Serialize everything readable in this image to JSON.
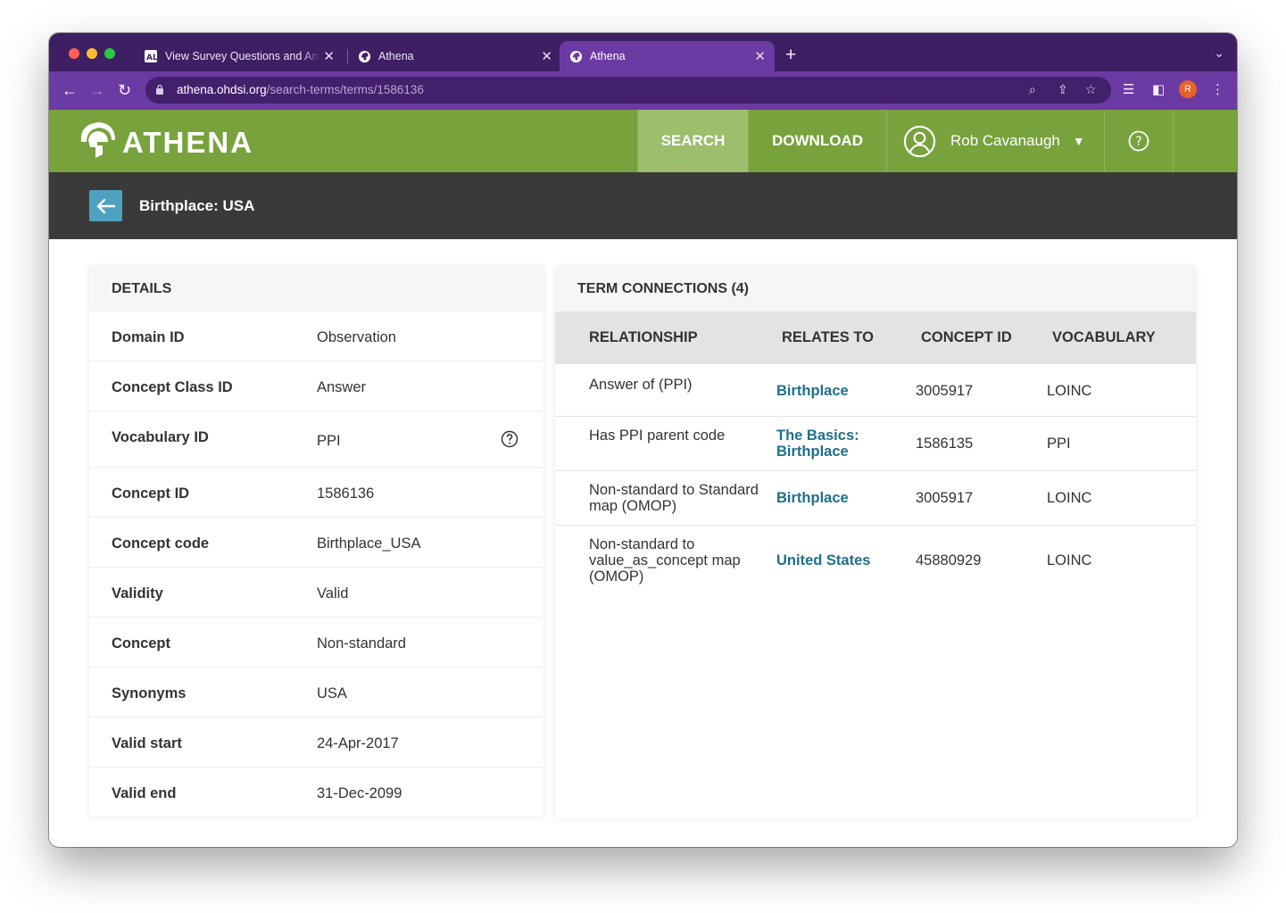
{
  "browser": {
    "tabs": [
      {
        "title": "View Survey Questions and Answers",
        "favicon": "survey-logo-icon"
      },
      {
        "title": "Athena",
        "favicon": "athena-helmet-icon"
      },
      {
        "title": "Athena",
        "favicon": "athena-helmet-icon",
        "active": true
      }
    ],
    "url_host": "athena.ohdsi.org",
    "url_path": "/search-terms/terms/1586136",
    "profile_initial": "R"
  },
  "app": {
    "logo_text": "ATHENA",
    "nav": {
      "search": "SEARCH",
      "download": "DOWNLOAD",
      "user": "Rob Cavanaugh",
      "help": "?"
    },
    "colors": {
      "header": "#78a23c",
      "active_nav": "#9cbe6d",
      "titlebar": "#3a3a3a",
      "back_button": "#4fa1c2",
      "link": "#1f6f8b"
    }
  },
  "page": {
    "title": "Birthplace: USA"
  },
  "details": {
    "heading": "DETAILS",
    "rows": [
      {
        "label": "Domain ID",
        "value": "Observation"
      },
      {
        "label": "Concept Class ID",
        "value": "Answer"
      },
      {
        "label": "Vocabulary ID",
        "value": "PPI"
      },
      {
        "label": "Concept ID",
        "value": "1586136"
      },
      {
        "label": "Concept code",
        "value": "Birthplace_USA"
      },
      {
        "label": "Validity",
        "value": "Valid"
      },
      {
        "label": "Concept",
        "value": "Non-standard"
      },
      {
        "label": "Synonyms",
        "value": "USA"
      },
      {
        "label": "Valid start",
        "value": "24-Apr-2017"
      },
      {
        "label": "Valid end",
        "value": "31-Dec-2099"
      }
    ]
  },
  "connections": {
    "heading": "TERM CONNECTIONS (4)",
    "columns": [
      "RELATIONSHIP",
      "RELATES TO",
      "CONCEPT ID",
      "VOCABULARY"
    ],
    "rows": [
      {
        "relationship": "Answer of (PPI)",
        "relates_to": "Birthplace",
        "concept_id": "3005917",
        "vocabulary": "LOINC"
      },
      {
        "relationship": "Has PPI parent code",
        "relates_to": "The Basics: Birthplace",
        "concept_id": "1586135",
        "vocabulary": "PPI"
      },
      {
        "relationship": "Non-standard to Standard map (OMOP)",
        "relates_to": "Birthplace",
        "concept_id": "3005917",
        "vocabulary": "LOINC"
      },
      {
        "relationship": "Non-standard to value_as_concept map (OMOP)",
        "relates_to": "United States",
        "concept_id": "45880929",
        "vocabulary": "LOINC"
      }
    ]
  }
}
